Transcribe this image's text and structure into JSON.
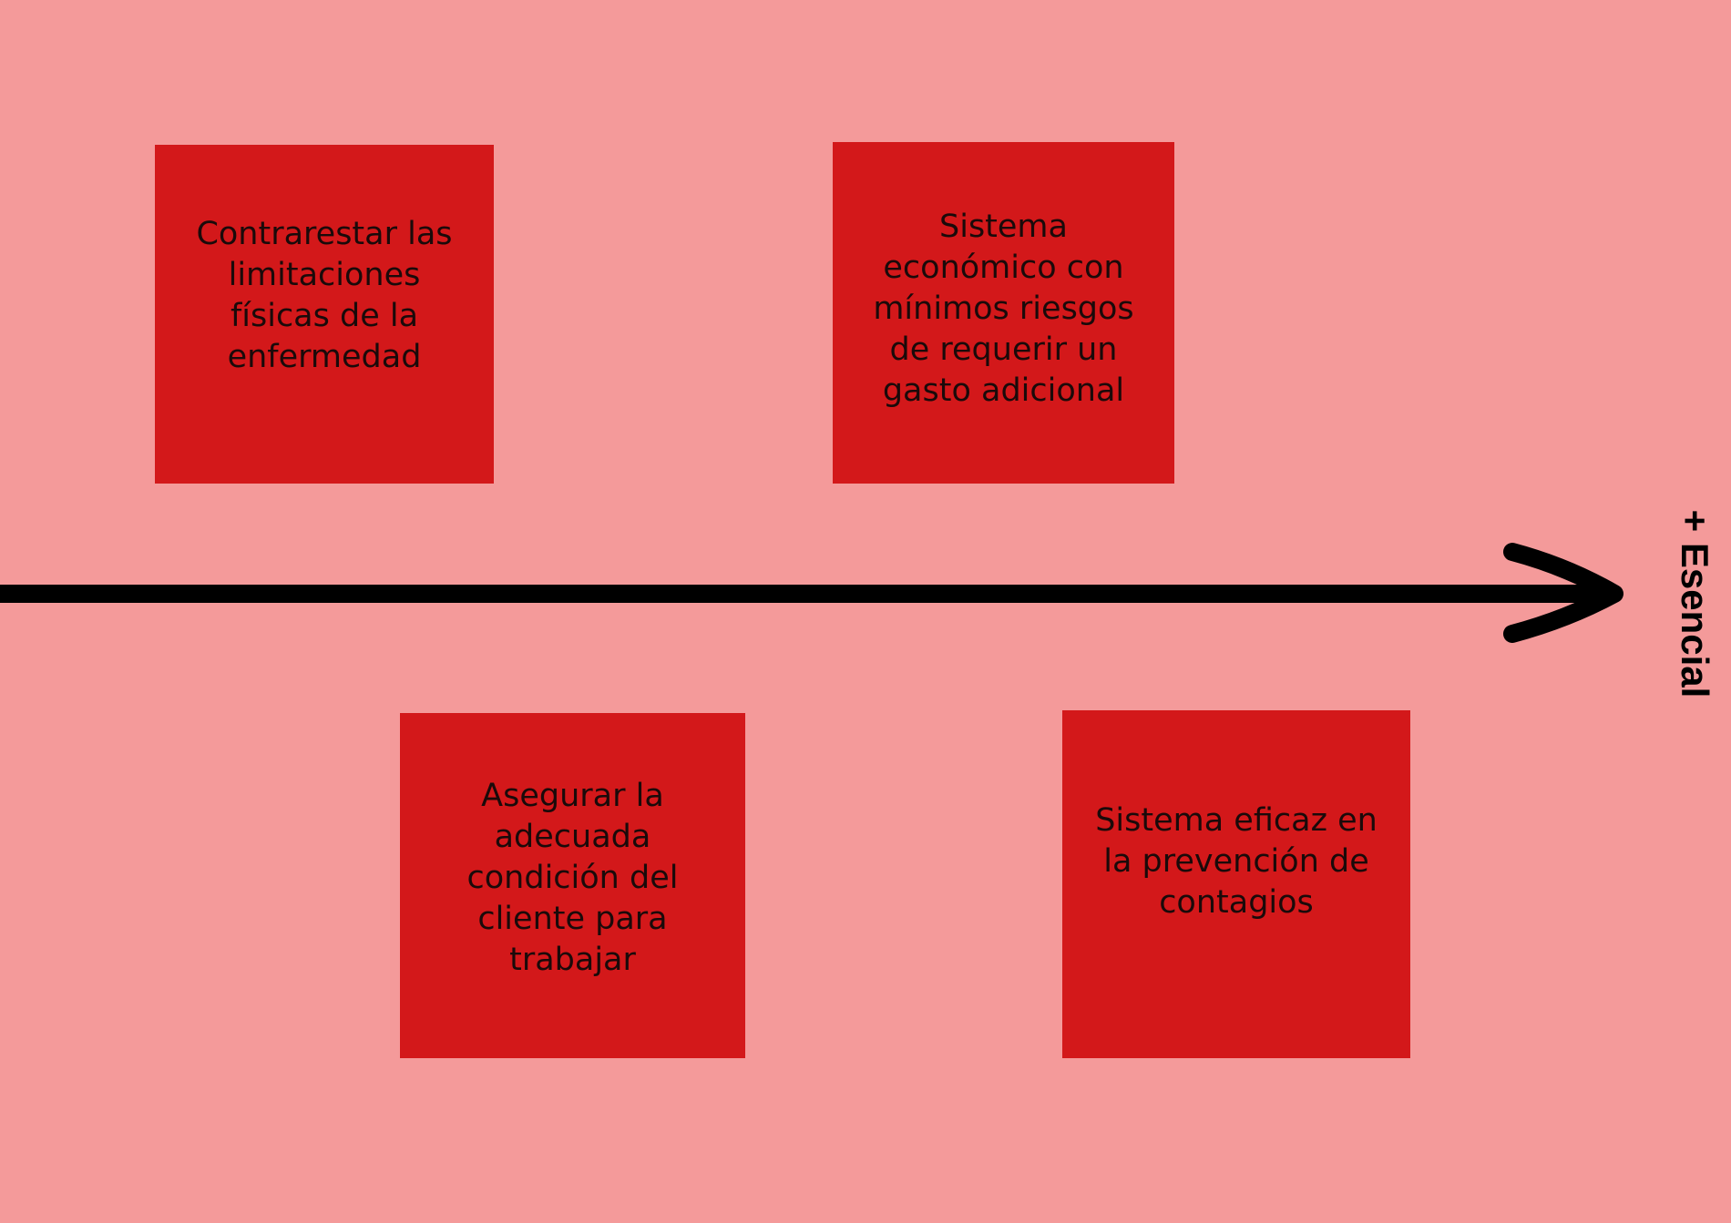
{
  "colors": {
    "background": "#f49a9a",
    "note_fill": "#d3181a",
    "arrow": "#000000"
  },
  "diagram": {
    "notes": [
      {
        "text": "Contrarestar las\nlimitaciones\nfísicas de la\nenfermedad"
      },
      {
        "text": "Sistema\neconómico con\nmínimos riesgos\nde requerir un\ngasto adicional"
      },
      {
        "text": "Asegurar la\nadecuada\ncondición del\ncliente para\ntrabajar"
      },
      {
        "text": "Sistema eficaz en\nla prevención de\ncontagios"
      }
    ],
    "axis_label": "+ Esencial"
  }
}
